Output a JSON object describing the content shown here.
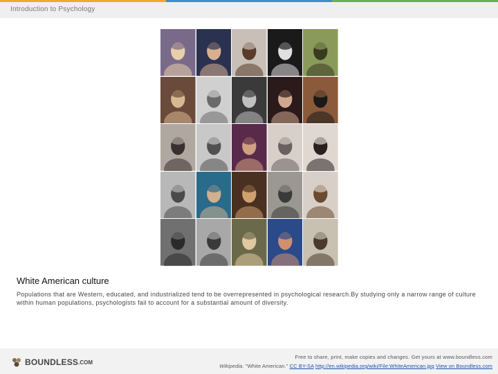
{
  "header": {
    "title": "Introduction to Psychology"
  },
  "colors": {
    "bar": [
      "#f0a830",
      "#3a8fd0",
      "#6ab04c"
    ],
    "header_bg": "#efefef",
    "footer_bg": "#f2f2f2",
    "link": "#1a4fa8"
  },
  "image": {
    "tiles": [
      {
        "bg": "#7a6a8a",
        "fg": "#e8cfa8"
      },
      {
        "bg": "#2a3250",
        "fg": "#d8b090"
      },
      {
        "bg": "#c8c0b8",
        "fg": "#5a3a2a"
      },
      {
        "bg": "#1a1a1a",
        "fg": "#e0e0e0"
      },
      {
        "bg": "#8a9a5a",
        "fg": "#3a3a20"
      },
      {
        "bg": "#6a4a3a",
        "fg": "#d8b890"
      },
      {
        "bg": "#d0d0d0",
        "fg": "#6a6a6a"
      },
      {
        "bg": "#3a3a3a",
        "fg": "#c0c0c0"
      },
      {
        "bg": "#2a1a1a",
        "fg": "#d0a890"
      },
      {
        "bg": "#8a5a3a",
        "fg": "#1a1a1a"
      },
      {
        "bg": "#b0a8a0",
        "fg": "#3a3030"
      },
      {
        "bg": "#c8c8c8",
        "fg": "#505050"
      },
      {
        "bg": "#5a2a4a",
        "fg": "#d0a080"
      },
      {
        "bg": "#d8d0c8",
        "fg": "#6a6060"
      },
      {
        "bg": "#e0d8d0",
        "fg": "#2a2020"
      },
      {
        "bg": "#b8b8b8",
        "fg": "#4a4a4a"
      },
      {
        "bg": "#2a6a8a",
        "fg": "#d0b090"
      },
      {
        "bg": "#4a3020",
        "fg": "#d0a070"
      },
      {
        "bg": "#9a9890",
        "fg": "#3a3a3a"
      },
      {
        "bg": "#d8d0c8",
        "fg": "#6a4a30"
      },
      {
        "bg": "#707070",
        "fg": "#2a2a2a"
      },
      {
        "bg": "#a8a8a8",
        "fg": "#3a3a3a"
      },
      {
        "bg": "#6a6a4a",
        "fg": "#e0c8a0"
      },
      {
        "bg": "#2a4a8a",
        "fg": "#d09070"
      },
      {
        "bg": "#c8c0b0",
        "fg": "#4a3a30"
      }
    ]
  },
  "caption": {
    "title": "White American culture",
    "text": "Populations that are Western, educated, and industrialized tend to be overrepresented in psychological research.By studying only a narrow range of culture within human populations, psychologists fail to account for a substantial amount of diversity."
  },
  "footer": {
    "logo_text": "BOUNDLESS",
    "logo_suffix": ".COM",
    "line1": "Free to share, print, make copies and changes. Get yours at www.boundless.com",
    "source": "Wikipedia.",
    "quote": " \"White American.\" ",
    "license": "CC BY-SA",
    "url": "http://en.wikipedia.org/wiki/File:WhiteAmerican.jpg",
    "view": "View on Boundless.com"
  }
}
